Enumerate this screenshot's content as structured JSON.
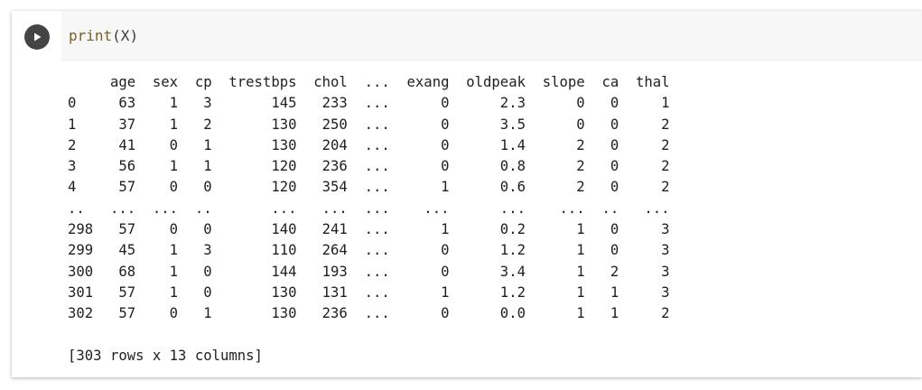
{
  "cell": {
    "code": {
      "func": "print",
      "args": "(X)"
    }
  },
  "output": {
    "lines": [
      "     age  sex  cp  trestbps  chol  ...  exang  oldpeak  slope  ca  thal",
      "0     63    1   3       145   233  ...      0      2.3      0   0     1",
      "1     37    1   2       130   250  ...      0      3.5      0   0     2",
      "2     41    0   1       130   204  ...      0      1.4      2   0     2",
      "3     56    1   1       120   236  ...      0      0.8      2   0     2",
      "4     57    0   0       120   354  ...      1      0.6      2   0     2",
      "..   ...  ...  ..       ...   ...  ...    ...      ...    ...  ..   ...",
      "298   57    0   0       140   241  ...      1      0.2      1   0     3",
      "299   45    1   3       110   264  ...      0      1.2      1   0     3",
      "300   68    1   0       144   193  ...      0      3.4      1   2     3",
      "301   57    1   0       130   131  ...      1      1.2      1   1     3",
      "302   57    0   1       130   236  ...      0      0.0      1   1     2"
    ],
    "summary": "[303 rows x 13 columns]"
  }
}
